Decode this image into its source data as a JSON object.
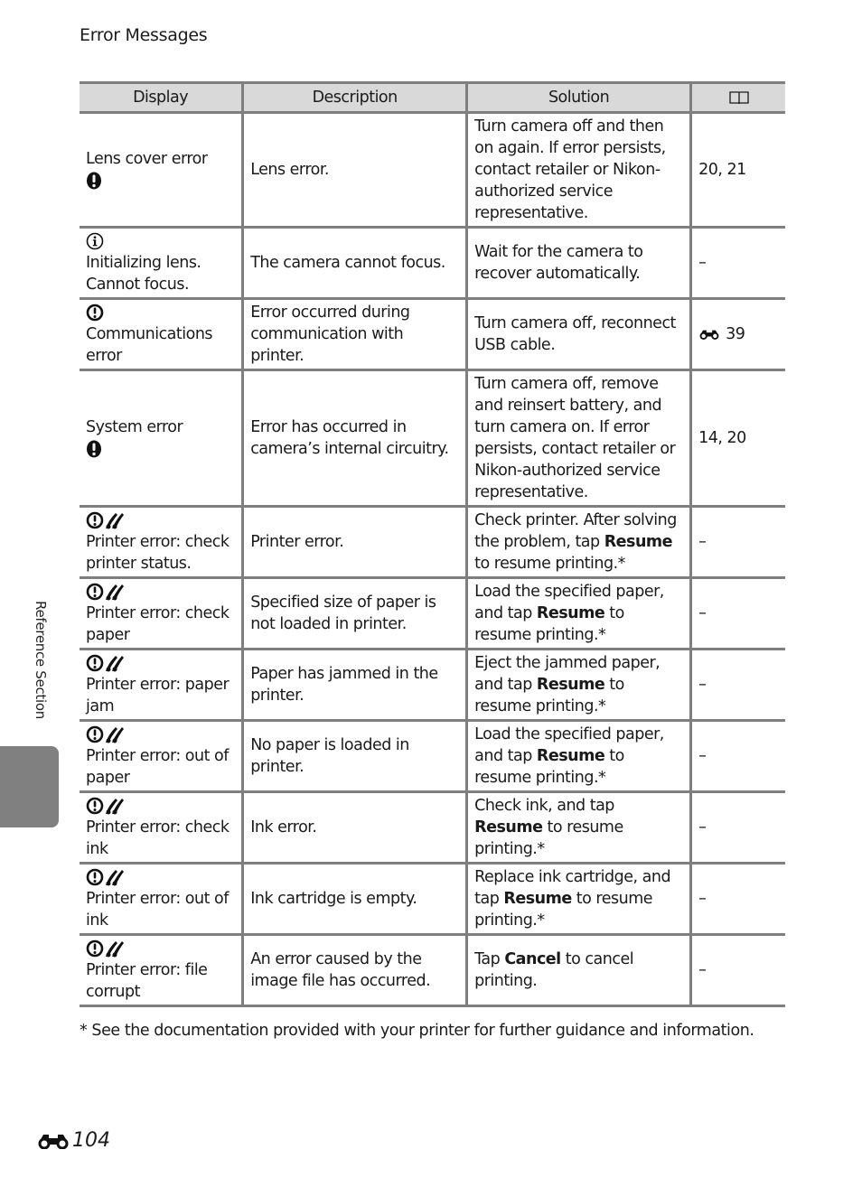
{
  "header": {
    "title": "Error Messages"
  },
  "table": {
    "columns": [
      "Display",
      "Description",
      "Solution"
    ],
    "reference_column_icon": "book-icon",
    "rows": [
      {
        "icon": "exclamation-solid-icon",
        "icon_position": "below",
        "display": "Lens cover error",
        "description": "Lens error.",
        "solution": [
          {
            "t": "Turn camera off and then on again. If error persists, contact retailer or Nikon-authorized service representative."
          }
        ],
        "reference": "20, 21"
      },
      {
        "icon": "info-circle-icon",
        "icon_position": "above",
        "display": "Initializing lens. Cannot focus.",
        "description": "The camera cannot focus.",
        "solution": [
          {
            "t": "Wait for the camera to recover automatically."
          }
        ],
        "reference": "–"
      },
      {
        "icon": "exclamation-circle-icon",
        "icon_position": "above",
        "display": "Communications error",
        "description": "Error occurred during communication with printer.",
        "solution": [
          {
            "t": "Turn camera off, reconnect USB cable."
          }
        ],
        "reference": "39",
        "reference_icon": "binoculars-icon"
      },
      {
        "icon": "exclamation-solid-icon",
        "icon_position": "below",
        "display": "System error",
        "description": "Error has occurred in camera’s internal circuitry.",
        "solution": [
          {
            "t": "Turn camera off, remove and reinsert battery, and turn camera on. If error persists, contact retailer or Nikon-authorized service representative."
          }
        ],
        "reference": "14, 20"
      },
      {
        "icon": "printer-error-icon",
        "icon_position": "above",
        "display": "Printer error: check printer status.",
        "description": "Printer error.",
        "solution": [
          {
            "t": "Check printer. After solving the problem, tap "
          },
          {
            "t": "Resume",
            "b": true
          },
          {
            "t": " to resume printing.*"
          }
        ],
        "reference": "–"
      },
      {
        "icon": "printer-error-icon",
        "icon_position": "above",
        "display": "Printer error: check paper",
        "description": "Specified size of paper is not loaded in printer.",
        "solution": [
          {
            "t": "Load the specified paper, and tap "
          },
          {
            "t": "Resume",
            "b": true
          },
          {
            "t": " to resume printing.*"
          }
        ],
        "reference": "–"
      },
      {
        "icon": "printer-error-icon",
        "icon_position": "above",
        "display": "Printer error: paper jam",
        "description": "Paper has jammed in the printer.",
        "solution": [
          {
            "t": "Eject the jammed paper, and tap "
          },
          {
            "t": "Resume",
            "b": true
          },
          {
            "t": " to resume printing.*"
          }
        ],
        "reference": "–"
      },
      {
        "icon": "printer-error-icon",
        "icon_position": "above",
        "display": "Printer error: out of paper",
        "description": "No paper is loaded in printer.",
        "solution": [
          {
            "t": "Load the specified paper, and tap "
          },
          {
            "t": "Resume",
            "b": true
          },
          {
            "t": " to resume printing.*"
          }
        ],
        "reference": "–"
      },
      {
        "icon": "printer-error-icon",
        "icon_position": "above",
        "display": "Printer error: check ink",
        "description": "Ink error.",
        "solution": [
          {
            "t": "Check ink, and tap "
          },
          {
            "t": "Resume",
            "b": true
          },
          {
            "t": " to resume printing.*"
          }
        ],
        "reference": "–"
      },
      {
        "icon": "printer-error-icon",
        "icon_position": "above",
        "display": "Printer error: out of ink",
        "description": "Ink cartridge is empty.",
        "solution": [
          {
            "t": "Replace ink cartridge, and tap "
          },
          {
            "t": "Resume",
            "b": true
          },
          {
            "t": " to resume printing.*"
          }
        ],
        "reference": "–"
      },
      {
        "icon": "printer-error-icon",
        "icon_position": "above",
        "display": "Printer error: file corrupt",
        "description": "An error caused by the image file has occurred.",
        "solution": [
          {
            "t": "Tap "
          },
          {
            "t": "Cancel",
            "b": true
          },
          {
            "t": " to cancel printing."
          }
        ],
        "reference": "–"
      }
    ]
  },
  "footnote": "*  See the documentation provided with your printer for further guidance and information.",
  "side_tab": {
    "label": "Reference Section",
    "color": "#808080"
  },
  "page_number": {
    "icon": "binoculars-icon",
    "number": "104"
  }
}
